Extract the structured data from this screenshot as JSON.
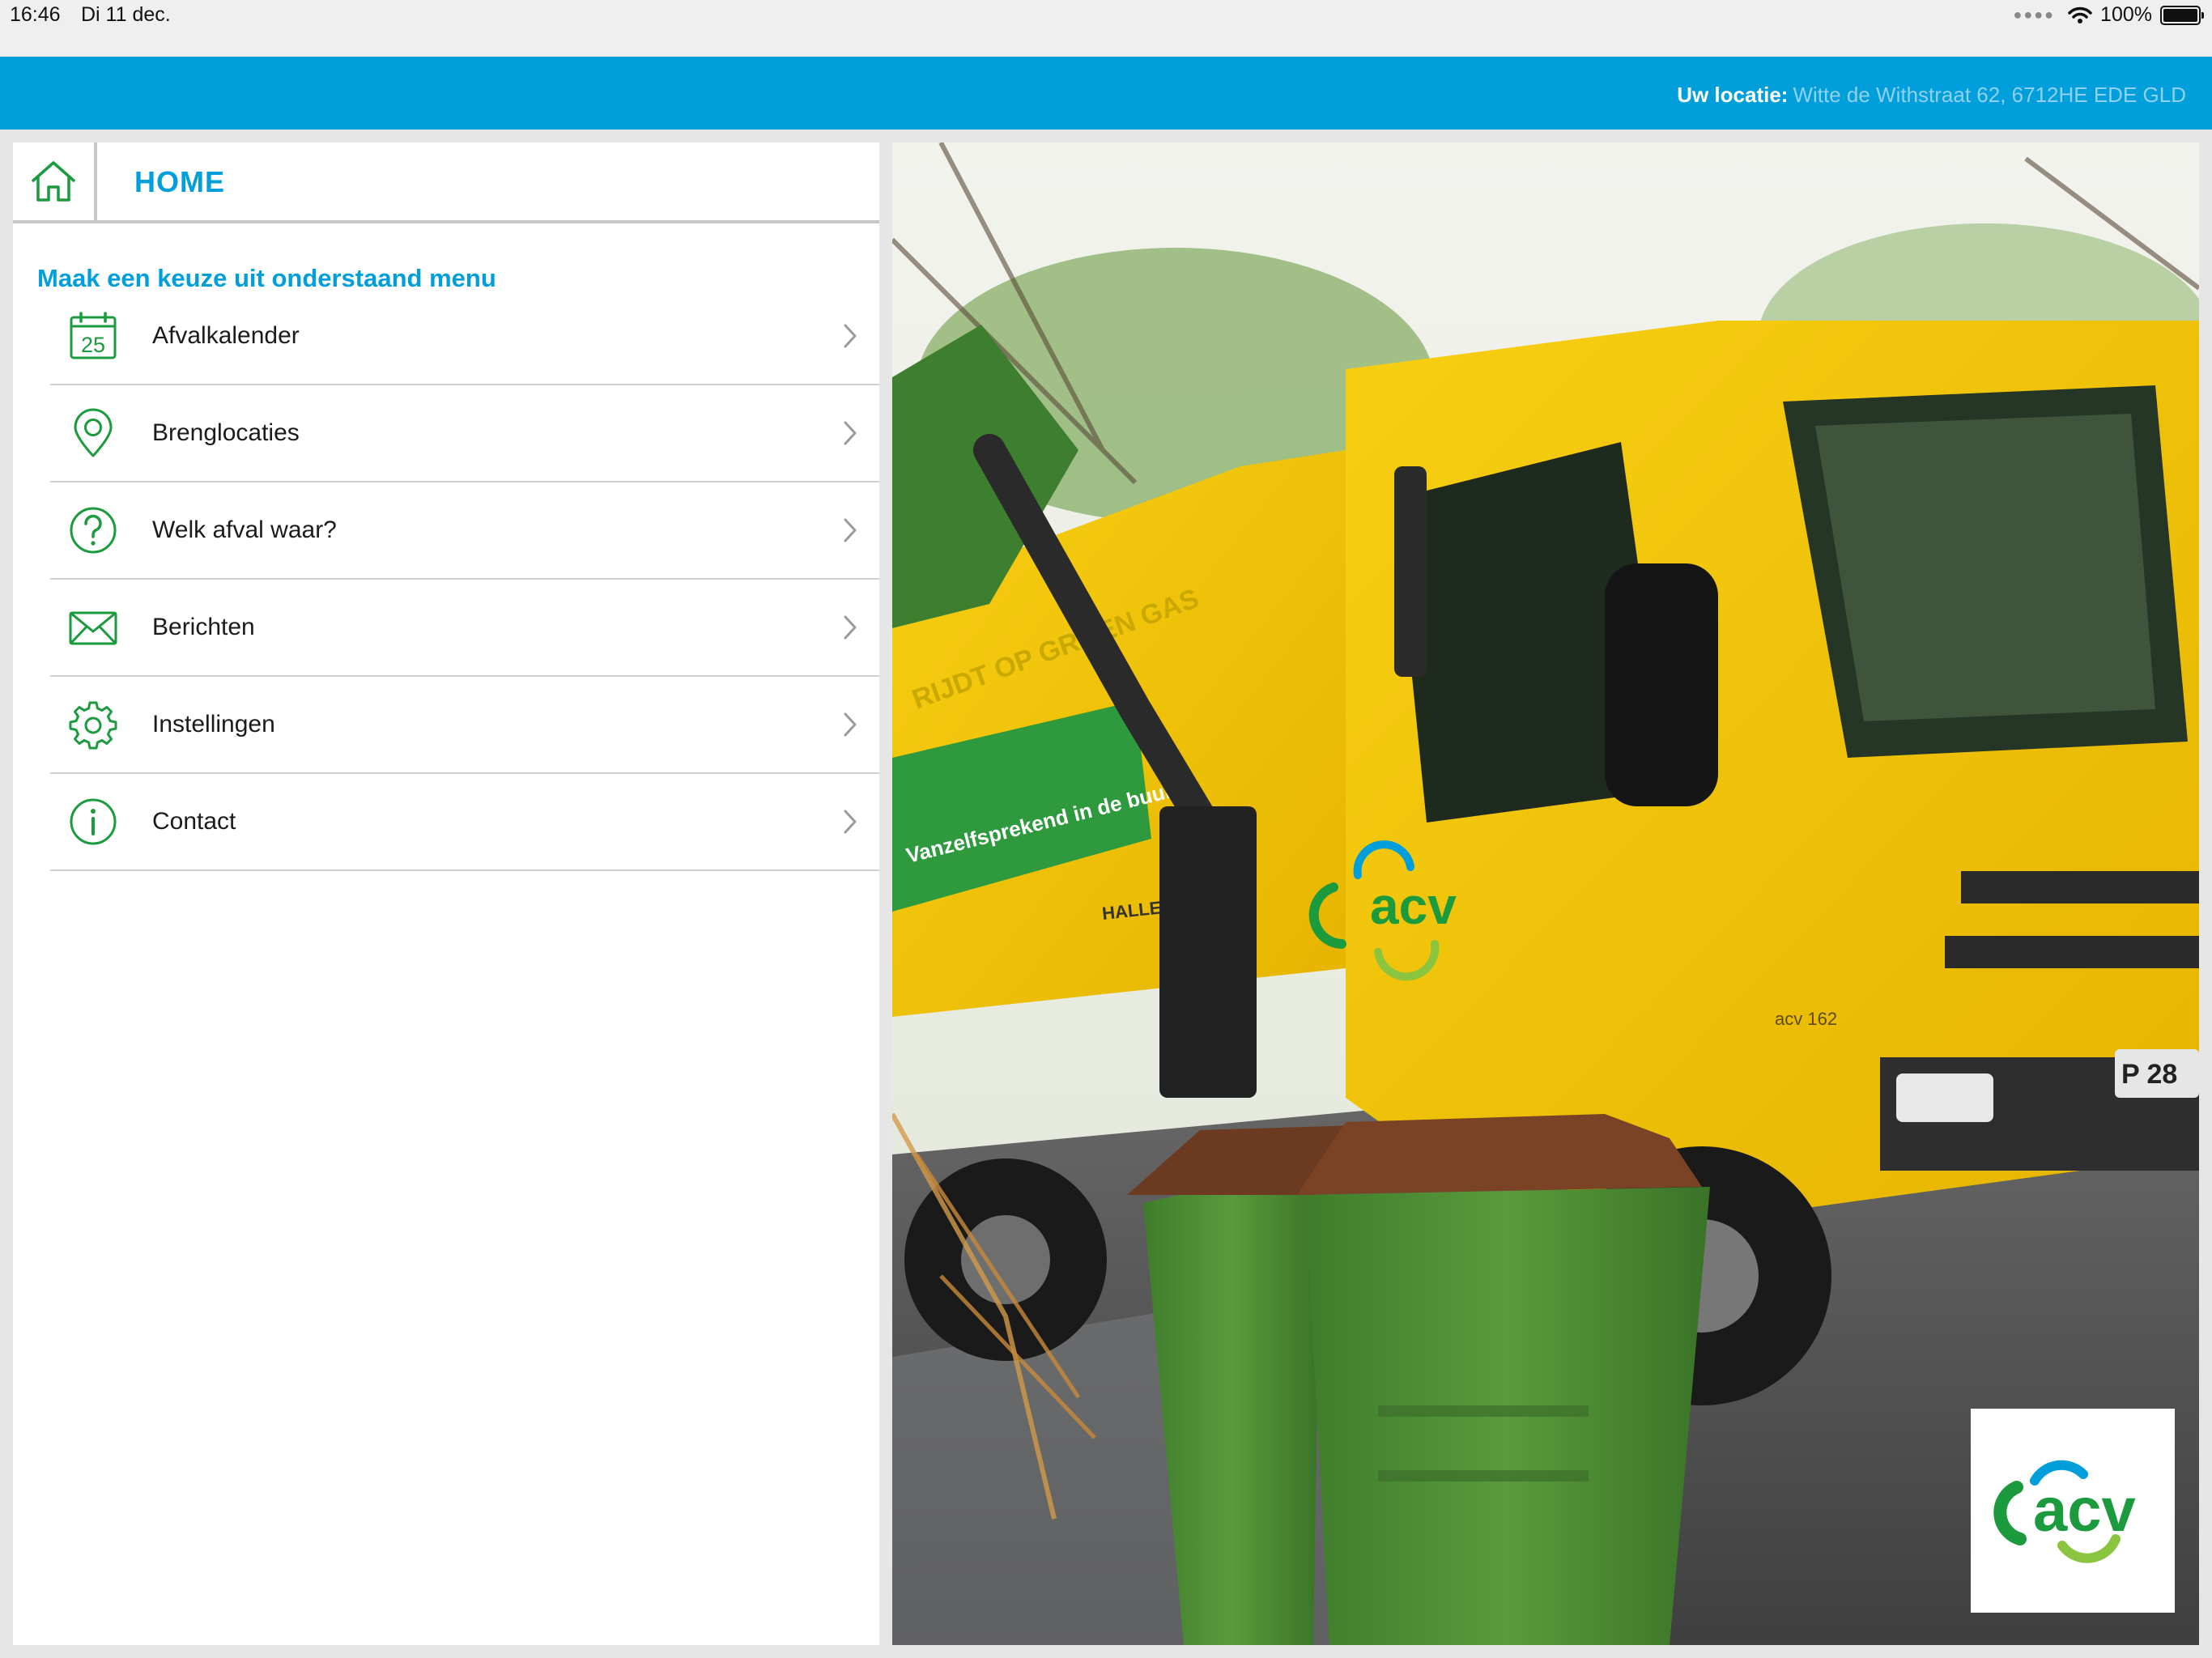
{
  "status_bar": {
    "time": "16:46",
    "date": "Di 11 dec.",
    "battery": "100%",
    "icons": [
      "signal-dots-icon",
      "wifi-icon",
      "battery-icon"
    ]
  },
  "header": {
    "location_label": "Uw locatie:",
    "location_value": "Witte de Withstraat 62, 6712HE EDE GLD",
    "color": "#009fdb"
  },
  "panel": {
    "title": "HOME",
    "subtitle": "Maak een keuze uit onderstaand menu",
    "accent_color": "#009fdb",
    "icon_color": "#1b9a3e",
    "items": [
      {
        "label": "Afvalkalender",
        "icon": "calendar-icon",
        "calendar_day": "25"
      },
      {
        "label": "Brenglocaties",
        "icon": "location-pin-icon"
      },
      {
        "label": "Welk afval waar?",
        "icon": "question-icon"
      },
      {
        "label": "Berichten",
        "icon": "envelope-icon"
      },
      {
        "label": "Instellingen",
        "icon": "gear-icon"
      },
      {
        "label": "Contact",
        "icon": "info-icon"
      }
    ]
  },
  "photo": {
    "description_icon": "garbage-truck-photo",
    "truck_text": {
      "brand": "acv",
      "fleet_number": "acv 162",
      "slogan": "Vanzelfsprekend in de buurt",
      "side_text": "RIJDT OP GROEN GAS",
      "body_maker": "HALLER",
      "plate": "P 28"
    },
    "logo_text": "acv"
  }
}
